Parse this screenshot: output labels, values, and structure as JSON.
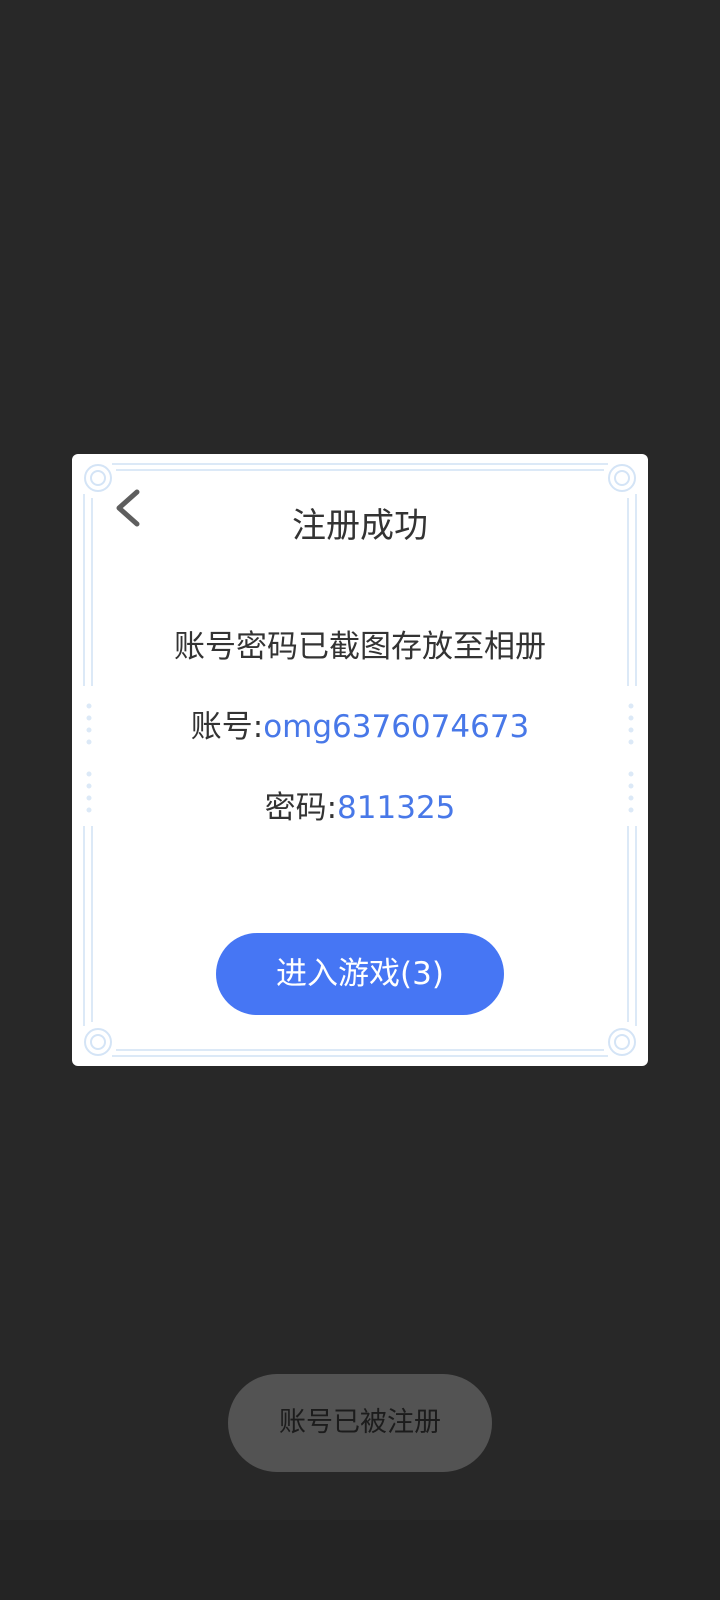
{
  "dialog": {
    "back_icon": "chevron-left-icon",
    "title": "注册成功",
    "message": "账号密码已截图存放至相册",
    "account_label": "账号:",
    "account_value": "omg6376074673",
    "password_label": "密码:",
    "password_value": "811325",
    "enter_button_label": "进入游戏(3)"
  },
  "toast": {
    "text": "账号已被注册"
  },
  "colors": {
    "background": "#282828",
    "dialog_bg": "#ffffff",
    "accent_blue": "#4676f4",
    "value_blue": "#4878e8",
    "toast_bg": "#535353",
    "frame_deco": "#dce9f7"
  }
}
